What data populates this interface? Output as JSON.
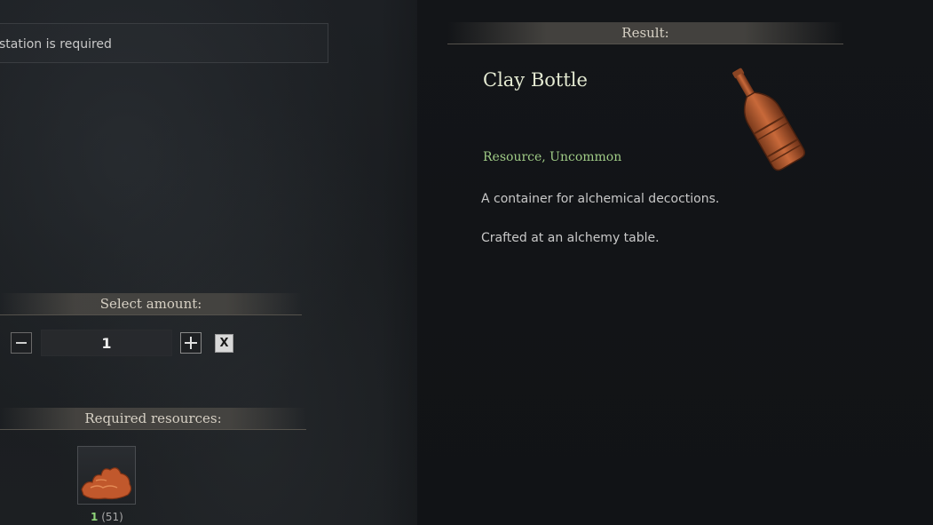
{
  "station": {
    "text": "station is required"
  },
  "result": {
    "header": "Result:",
    "item_name": "Clay Bottle",
    "tags": "Resource, Uncommon",
    "description": "A container for alchemical decoctions.",
    "crafted_at": "Crafted at an alchemy table.",
    "icon": "clay-bottle-icon"
  },
  "amount": {
    "header": "Select amount:",
    "value": "1",
    "minus_icon": "minus-icon",
    "plus_icon": "plus-icon",
    "clear_label": "X"
  },
  "resources": {
    "header": "Required resources:",
    "items": [
      {
        "icon": "clay-icon",
        "required": "1",
        "owned": "(51)"
      }
    ]
  },
  "colors": {
    "title": "#e4ead2",
    "tags": "#9fcb86",
    "required_count": "#8fd47a"
  }
}
